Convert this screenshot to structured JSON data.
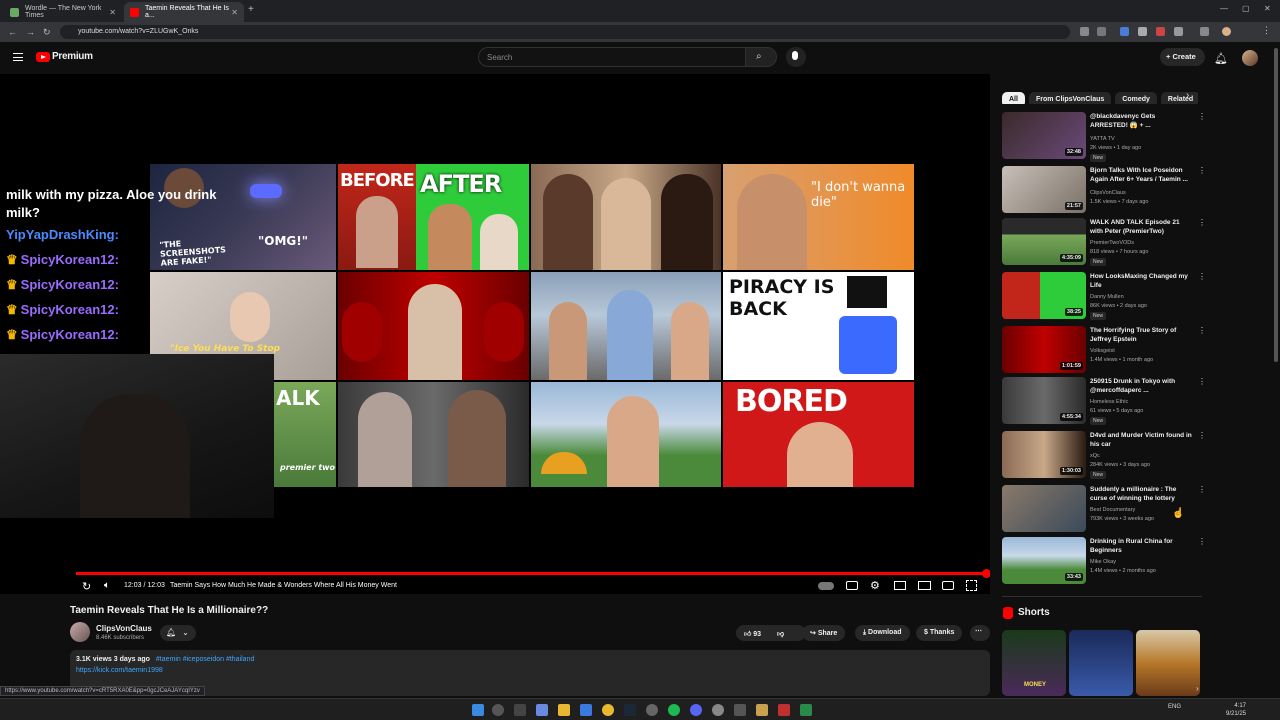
{
  "browser": {
    "tabs": [
      {
        "label": "Wordle — The New York Times"
      },
      {
        "label": "Taemin Reveals That He Is a..."
      }
    ],
    "url": "youtube.com/watch?v=ZLUGwK_Onks",
    "status_url": "https://www.youtube.com/watch?v=cRT5RXA0E&pp=0gcJCeAJAYcqIYzv"
  },
  "header": {
    "brand": "Premium",
    "search_placeholder": "Search",
    "create_label": "Create"
  },
  "player": {
    "chat": {
      "message": "milk with my pizza. Aloe you drink milk?",
      "lines": [
        {
          "name": "YipYapDrashKing:"
        },
        {
          "name": "SpicyKorean12:"
        },
        {
          "name": "SpicyKorean12:"
        },
        {
          "name": "SpicyKorean12:"
        },
        {
          "name": "SpicyKorean12:"
        }
      ]
    },
    "thumb_texts": {
      "screenshots": "\"THE SCREENSHOTS ARE FAKE!\"",
      "omg": "\"OMG!\"",
      "before": "BEFORE",
      "after": "AFTER",
      "dont_wanna": "\"I don't wanna die\"",
      "ice": "\"Ice You Have To Stop",
      "piracy": "PIRACY IS BACK",
      "walk": "ALK",
      "premier": "premier two",
      "bored": "BORED"
    },
    "time": "12:03 / 12:03",
    "chapter": "Taemin Says How Much He Made & Wonders Where All His Money Went",
    "progress_percent": 100
  },
  "video": {
    "title": "Taemin Reveals That He Is a Millionaire??",
    "channel": "ClipsVonClaus",
    "subscribers": "8.46K subscribers",
    "likes": "93",
    "share": "Share",
    "download": "Download",
    "thanks": "Thanks",
    "stats": "3.1K views  3 days ago",
    "tags": "#taemin #iceposeidon #thailand",
    "link": "https://kick.com/taemin1998"
  },
  "sidebar": {
    "chips": [
      {
        "label": "All"
      },
      {
        "label": "From ClipsVonClaus"
      },
      {
        "label": "Comedy"
      },
      {
        "label": "Related"
      }
    ],
    "recommendations": [
      {
        "title": "@blackdavenyc Gets ARRESTED! 😱 + ...",
        "channel": "YATTA TV",
        "meta": "2K views • 1 day ago",
        "badge": "New",
        "duration": "32:48"
      },
      {
        "title": "Bjorn Talks With Ice Poseidon Again After 6+ Years / Taemin ...",
        "channel": "ClipsVonClaus",
        "meta": "1.5K views • 7 days ago",
        "badge": "",
        "duration": "21:57"
      },
      {
        "title": "WALK AND TALK Episode 21 with Peter (PremierTwo)",
        "channel": "PremierTwoVODs",
        "meta": "818 views • 7 hours ago",
        "badge": "New",
        "duration": "4:35:09"
      },
      {
        "title": "How LooksMaxing Changed my Life",
        "channel": "Danny Mullen",
        "meta": "86K views • 2 days ago",
        "badge": "New",
        "duration": "38:25"
      },
      {
        "title": "The Horrifying True Story of Jeffrey Epstein",
        "channel": "Volksgeist",
        "meta": "1.4M views • 1 month ago",
        "badge": "",
        "duration": "1:01:59"
      },
      {
        "title": "250915 Drunk in Tokyo with @mercoffdaperc ...",
        "channel": "Homeless Ethic",
        "meta": "61 views • 5 days ago",
        "badge": "New",
        "duration": "4:55:34"
      },
      {
        "title": "D4vd and Murder Victim found in his car",
        "channel": "xQc",
        "meta": "284K views • 3 days ago",
        "badge": "New",
        "duration": "1:30:03"
      },
      {
        "title": "Suddenly a millionaire : The curse of winning the lottery",
        "channel": "Best Documentary",
        "meta": "793K views • 3 weeks ago",
        "badge": "",
        "duration": ""
      },
      {
        "title": "Drinking in Rural China for Beginners",
        "channel": "Mike Okay",
        "meta": "1.4M views • 2 months ago",
        "badge": "",
        "duration": "33:43"
      }
    ],
    "shorts_label": "Shorts",
    "shorts": [
      {
        "caption": "MONEY"
      },
      {
        "caption": ""
      },
      {
        "caption": ""
      }
    ]
  },
  "taskbar": {
    "lang": "ENG",
    "time": "4:17",
    "date": "9/21/25"
  }
}
